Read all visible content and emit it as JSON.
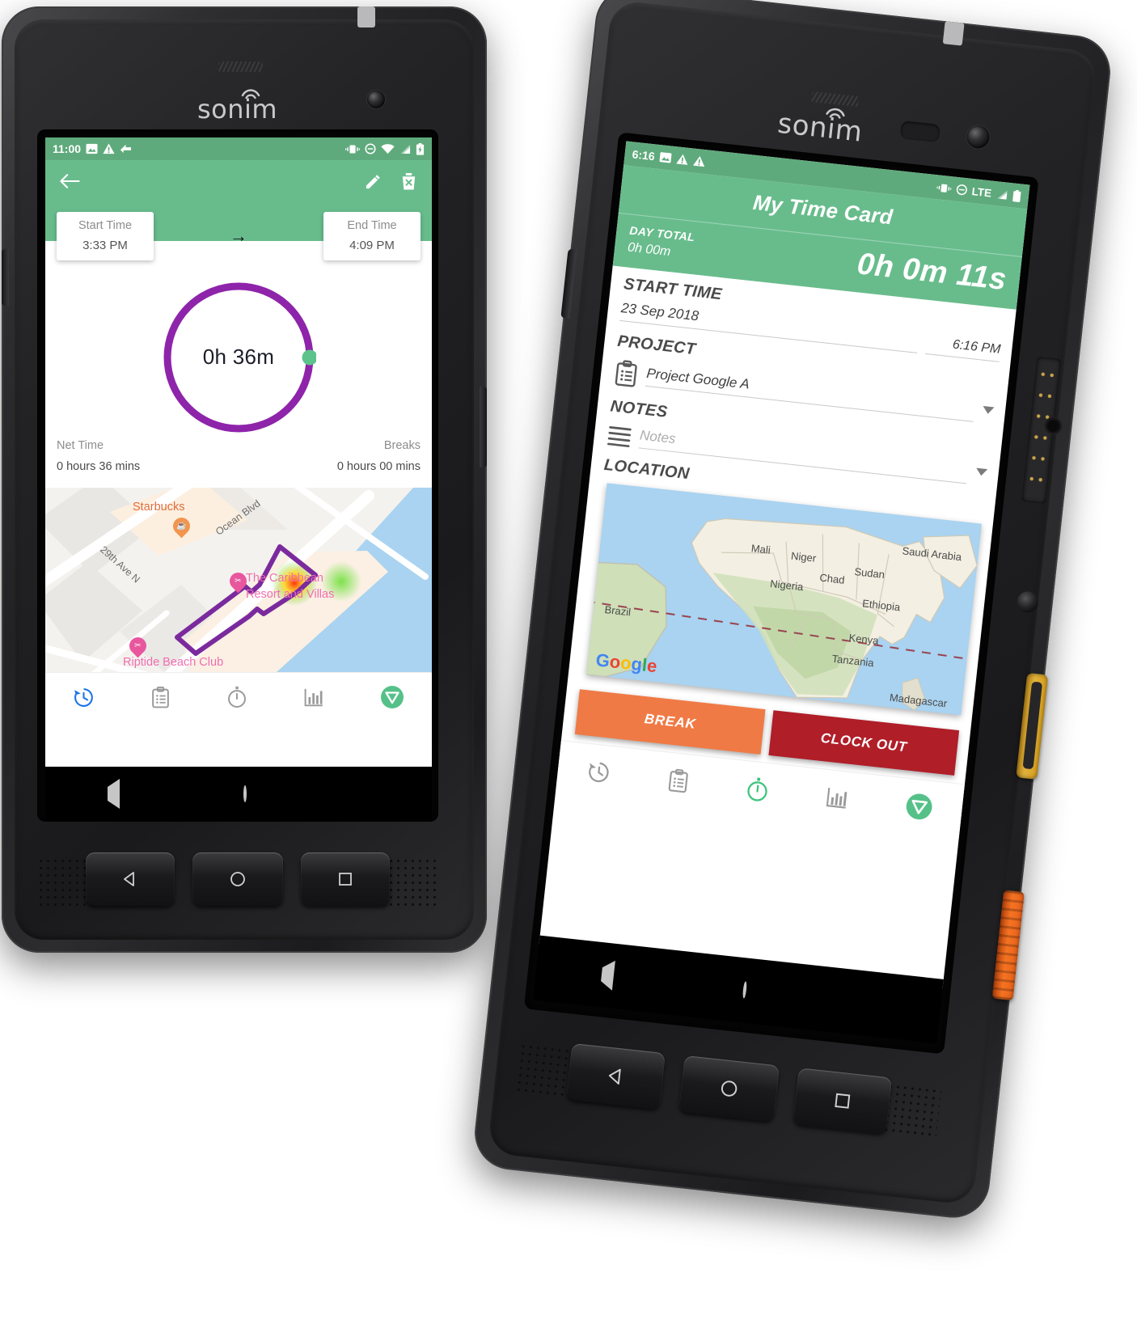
{
  "brand": {
    "logo_text": "sonim",
    "wifi_icon": "wifi-arc-icon"
  },
  "left_phone": {
    "statusbar": {
      "time": "11:00",
      "left_icons": [
        "image-icon",
        "warning-icon",
        "sync-icon"
      ],
      "right_icons": [
        "vibrate-icon",
        "dnd-icon",
        "wifi-icon",
        "signal-icon",
        "battery-charging-icon"
      ]
    },
    "appbar": {
      "back_icon": "arrow-back-icon",
      "edit_icon": "pencil-icon",
      "delete_icon": "trash-delete-icon"
    },
    "start_card": {
      "label": "Start Time",
      "value": "3:33 PM"
    },
    "end_card": {
      "label": "End Time",
      "value": "4:09 PM"
    },
    "arrow": "→",
    "ring": {
      "center_text": "0h 36m",
      "ring_color": "#8e24aa",
      "handle_color": "#5cc48b",
      "progress_pct": 98
    },
    "stats": {
      "net_label": "Net Time",
      "net_value": "0 hours 36 mins",
      "breaks_label": "Breaks",
      "breaks_value": "0 hours 00 mins"
    },
    "map": {
      "labels": [
        "Starbucks",
        "Ocean Blvd",
        "29th Ave N",
        "The Caribbean",
        "Resort and Villas",
        "Riptide Beach Club"
      ],
      "geofence_color": "#7b2a9e",
      "water_color": "#a9d3f0"
    },
    "tabbar": {
      "items": [
        {
          "name": "history",
          "icon": "history-clock-icon",
          "active": true
        },
        {
          "name": "timecard",
          "icon": "clipboard-list-icon",
          "active": false
        },
        {
          "name": "timer",
          "icon": "stopwatch-icon",
          "active": false
        },
        {
          "name": "reports",
          "icon": "bar-chart-icon",
          "active": false
        },
        {
          "name": "logo",
          "icon": "v-badge-icon",
          "active": false
        }
      ],
      "active_color": "#1a73e8",
      "inactive_color": "#9a9a9a",
      "badge_color": "#55c189"
    },
    "softnav": {
      "back": "triangle-back-icon",
      "home": "circle-home-icon",
      "recents": "square-recents-icon"
    },
    "hardware_buttons": [
      "hw-back-button",
      "hw-home-button",
      "hw-recents-button"
    ]
  },
  "right_phone": {
    "statusbar": {
      "time": "6:16",
      "left_icons": [
        "image-icon",
        "warning-icon",
        "warning-icon"
      ],
      "right_icons": [
        "vibrate-icon",
        "dnd-icon",
        "LTE",
        "signal-icon",
        "battery-icon"
      ],
      "network_label": "LTE"
    },
    "title": "My Time Card",
    "day_total": {
      "label": "DAY TOTAL",
      "value": "0h 00m",
      "running": "0h 0m 11s"
    },
    "sections": {
      "start_time": {
        "heading": "START TIME",
        "date": "23 Sep 2018",
        "time": "6:16 PM"
      },
      "project": {
        "heading": "PROJECT",
        "icon": "clipboard-list-icon",
        "value": "Project Google A",
        "dropdown_icon": "caret-down-icon"
      },
      "notes": {
        "heading": "NOTES",
        "icon": "lines-notes-icon",
        "placeholder": "Notes",
        "value": "",
        "dropdown_icon": "caret-down-icon"
      },
      "location": {
        "heading": "LOCATION"
      }
    },
    "map": {
      "labels": [
        "Mali",
        "Niger",
        "Sudan",
        "Saudi Arabia",
        "Chad",
        "Nigeria",
        "Ethiopia",
        "Brazil",
        "Kenya",
        "Tanzania",
        "Madagascar"
      ],
      "attribution": "Google",
      "water_color": "#a9d3f0",
      "land_color": "#f3efe2"
    },
    "buttons": {
      "break": {
        "label": "BREAK",
        "color": "#f07a45"
      },
      "clock_out": {
        "label": "CLOCK OUT",
        "color": "#b01e28"
      }
    },
    "tabbar": {
      "items": [
        {
          "name": "history",
          "icon": "history-clock-icon",
          "active": false
        },
        {
          "name": "timecard",
          "icon": "clipboard-list-icon",
          "active": false
        },
        {
          "name": "timer",
          "icon": "stopwatch-icon",
          "active": true
        },
        {
          "name": "reports",
          "icon": "bar-chart-icon",
          "active": false
        },
        {
          "name": "logo",
          "icon": "v-badge-icon",
          "active": false
        }
      ],
      "active_color": "#3ec47e",
      "inactive_color": "#9a9a9a",
      "badge_color": "#55c189"
    },
    "softnav": {
      "back": "triangle-back-icon",
      "home": "circle-home-icon",
      "recents": "square-recents-icon"
    },
    "side_buttons": [
      {
        "name": "ptt-yellow-button",
        "color": "#d8a01e"
      },
      {
        "name": "sos-orange-button",
        "color": "#e8621b"
      }
    ],
    "hardware_buttons": [
      "hw-back-button",
      "hw-home-button",
      "hw-recents-button"
    ]
  },
  "theme": {
    "green": "#68bc8c",
    "status_green": "#5faa7c",
    "purple": "#8e24aa",
    "orange": "#f07a45",
    "dark_red": "#b01e28"
  }
}
